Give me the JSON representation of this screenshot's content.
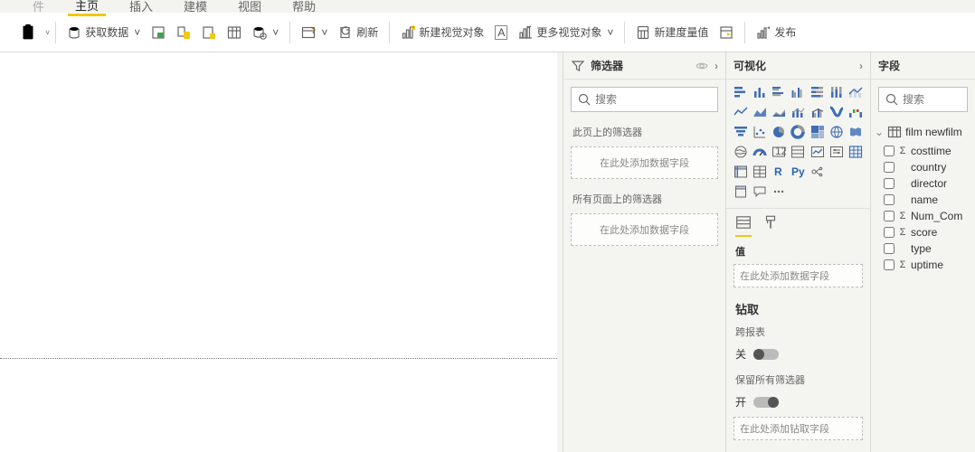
{
  "ribbon_tabs": {
    "t0": "件",
    "t1": "主页",
    "t2": "插入",
    "t3": "建模",
    "t4": "视图",
    "t5": "帮助"
  },
  "toolbar": {
    "get_data": "获取数据",
    "refresh": "刷新",
    "new_visual": "新建视觉对象",
    "more_visuals": "更多视觉对象",
    "new_measure": "新建度量值",
    "publish": "发布"
  },
  "filters": {
    "title": "筛选器",
    "search_ph": "搜索",
    "page_label": "此页上的筛选器",
    "page_drop": "在此处添加数据字段",
    "all_label": "所有页面上的筛选器",
    "all_drop": "在此处添加数据字段"
  },
  "viz": {
    "title": "可视化",
    "values_label": "值",
    "values_drop": "在此处添加数据字段",
    "drill_title": "钻取",
    "cross_label": "跨报表",
    "cross_state": "关",
    "keepall_label": "保留所有筛选器",
    "keepall_state": "开",
    "drill_drop": "在此处添加钻取字段"
  },
  "fields": {
    "title": "字段",
    "search_ph": "搜索",
    "table": "film newfilm",
    "items": [
      {
        "name": "costtime",
        "sigma": true
      },
      {
        "name": "country",
        "sigma": false
      },
      {
        "name": "director",
        "sigma": false
      },
      {
        "name": "name",
        "sigma": false
      },
      {
        "name": "Num_Com",
        "sigma": true
      },
      {
        "name": "score",
        "sigma": true
      },
      {
        "name": "type",
        "sigma": false
      },
      {
        "name": "uptime",
        "sigma": true
      }
    ]
  }
}
